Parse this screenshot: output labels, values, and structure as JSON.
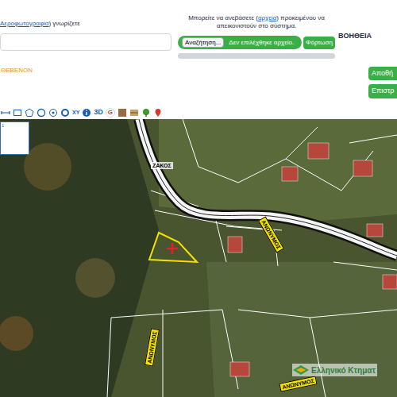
{
  "top_bar": {
    "link": "Αεροφωτογραφία",
    "text": ") γνωρίζετε",
    "input_value": "",
    "note": "ΘΕΒΕΝΟΝ"
  },
  "upload": {
    "text_before": "Μπορείτε να ανεβάσετε (",
    "link": "αρχεία",
    "text_after": ") προκειμένου να απεικονιστούν στο σύστημα.",
    "browse_button": "Αναζήτηση...",
    "file_status": "Δεν επιλέχθηκε αρχείο.",
    "load_button": "Φόρτωση",
    "level": 0
  },
  "help": "ΒΟΗΘΕΙΑ",
  "actions": [
    "Αποθή",
    "Επιστρ"
  ],
  "toolbar": {
    "labels": [
      "XY",
      "3D",
      "G"
    ]
  },
  "map": {
    "legend": "1",
    "labels": [
      {
        "text": "ΖΑΚΟΣ",
        "kind": "road"
      },
      {
        "text": "ΑΝΩΝΥΜΟΣ",
        "kind": "tag"
      },
      {
        "text": "ΑΝΩΝΥΜΟΣ",
        "kind": "tag"
      },
      {
        "text": "ΑΝΩΝΥΜΟΣ",
        "kind": "tag"
      }
    ],
    "parcel_selected": true,
    "logo": "Ελληνικό Κτηματ"
  }
}
